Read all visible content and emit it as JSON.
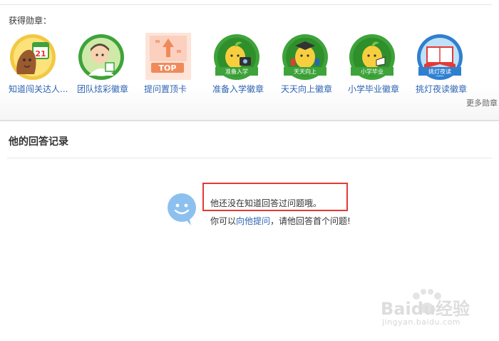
{
  "badges_section": {
    "heading": "获得勋章：",
    "items": [
      {
        "label": "知道闯关达人...",
        "overlay": "21"
      },
      {
        "label": "团队炫彩徽章",
        "overlay": ""
      },
      {
        "label": "提问置顶卡",
        "overlay": "TOP"
      },
      {
        "label": "准备入学徽章",
        "overlay": "准备入学"
      },
      {
        "label": "天天向上徽章",
        "overlay": "天天向上"
      },
      {
        "label": "小学毕业徽章",
        "overlay": "小学毕业"
      },
      {
        "label": "挑灯夜读徽章",
        "overlay": "挑灯夜读"
      }
    ],
    "more_label": "更多勋章"
  },
  "answers_section": {
    "heading": "他的回答记录",
    "empty_message": "他还没在知道回答过问题哦。",
    "suggest_prefix": "你可以",
    "suggest_link": "向他提问",
    "suggest_suffix": "，请他回答首个问题!"
  },
  "watermark": {
    "logo_text": "Baidu经验",
    "url": "jingyan.baidu.com"
  },
  "colors": {
    "link": "#2d64b3",
    "highlight": "#e53935",
    "badge_green": "#3ea33a",
    "bubble_blue": "#8cc0ef"
  }
}
